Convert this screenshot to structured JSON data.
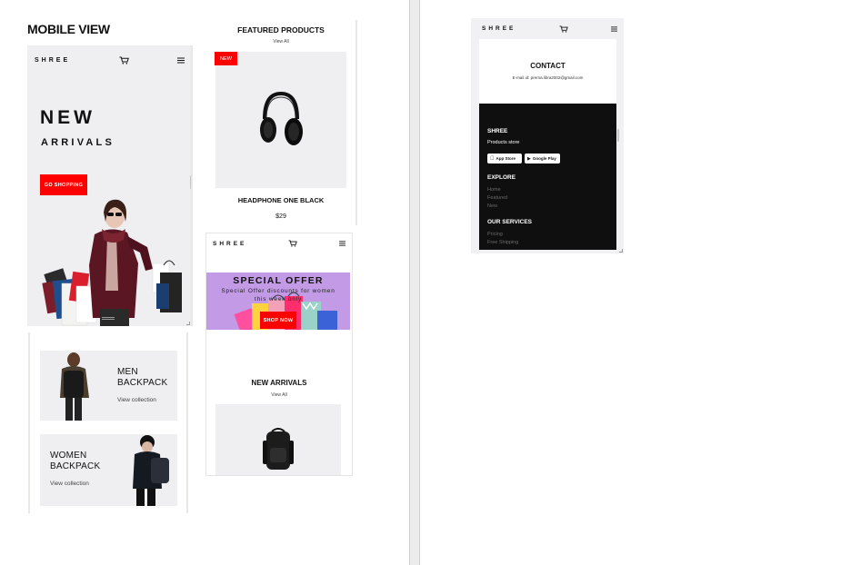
{
  "page": {
    "heading": "MOBILE VIEW"
  },
  "brand": "SHREE",
  "hero": {
    "title_line1": "NEW",
    "title_line2": "ARRIVALS",
    "cta_label": "GO SHOPPING"
  },
  "featured": {
    "title": "FEATURED PRODUCTS",
    "view_all": "View All",
    "badge": "NEW",
    "product_name": "HEADPHONE ONE BLACK",
    "product_price": "$29"
  },
  "special": {
    "title": "SPECIAL OFFER",
    "subtitle": "Special Offer discounts for women",
    "subtitle2": "this week only",
    "cta_label": "SHOP NOW",
    "arrivals_title": "NEW ARRIVALS",
    "arrivals_link": "View All"
  },
  "backpacks": {
    "men_line1": "MEN",
    "men_line2": "BACKPACK",
    "men_link": "View collection",
    "women_line1": "WOMEN",
    "women_line2": "BACKPACK",
    "women_link": "View collection"
  },
  "contact": {
    "title": "CONTACT",
    "email_line": "E-mail id: prerna.libra2002@gmail.com"
  },
  "footer": {
    "brand": "SHREE",
    "tagline": "Products store",
    "app_store_small": "Download on the",
    "app_store": "App Store",
    "google_small": "GET IT ON",
    "google_play": "Google Play",
    "explore_title": "EXPLORE",
    "explore_links": [
      "Home",
      "Featured",
      "New"
    ],
    "services_title": "OUR SERVICES",
    "services_links": [
      "Pricing",
      "Free Shipping"
    ]
  },
  "colors": {
    "accent": "#ff0000",
    "offer_bg": "#c39ae6",
    "footer_bg": "#0f0f0f",
    "panel_bg": "#efeff1"
  }
}
